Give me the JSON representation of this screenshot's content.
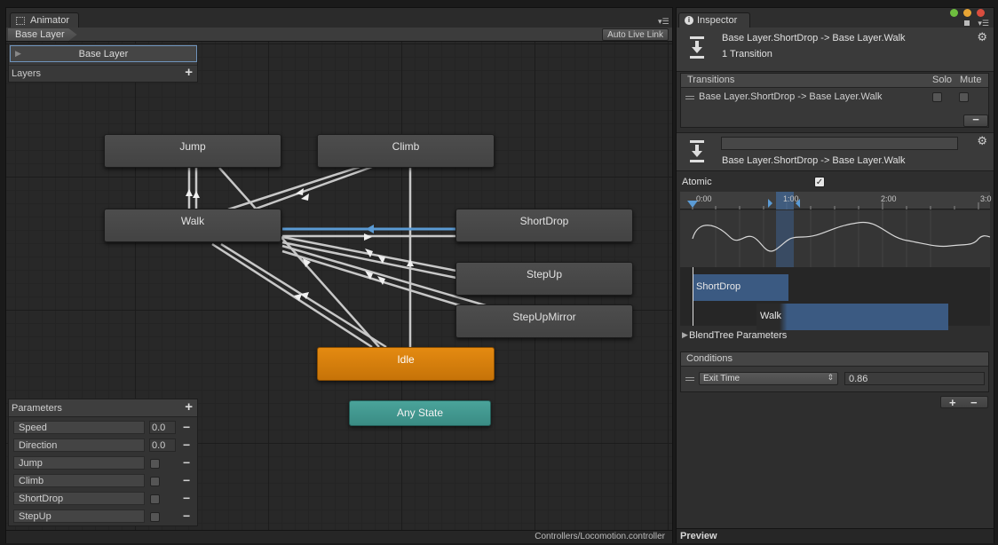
{
  "animator": {
    "tab_title": "Animator",
    "breadcrumb": "Base Layer",
    "auto_live_link": "Auto Live Link",
    "footer_path": "Controllers/Locomotion.controller",
    "layers": {
      "selected_layer": "Base Layer",
      "header": "Layers",
      "add_icon": "plus-icon"
    },
    "parameters": {
      "header": "Parameters",
      "items": [
        {
          "name": "Speed",
          "type": "float",
          "value": "0.0"
        },
        {
          "name": "Direction",
          "type": "float",
          "value": "0.0"
        },
        {
          "name": "Jump",
          "type": "bool",
          "checked": false
        },
        {
          "name": "Climb",
          "type": "bool",
          "checked": false
        },
        {
          "name": "ShortDrop",
          "type": "bool",
          "checked": false
        },
        {
          "name": "StepUp",
          "type": "bool",
          "checked": false
        }
      ]
    },
    "states": {
      "jump": "Jump",
      "climb": "Climb",
      "walk": "Walk",
      "shortdrop": "ShortDrop",
      "stepup": "StepUp",
      "stepupmirror": "StepUpMirror",
      "idle": "Idle",
      "any_state": "Any State"
    },
    "colors": {
      "node": "#484848",
      "default_state": "#d97f0e",
      "any_state": "#43998f",
      "selected_transition": "#5b9bd5",
      "transition": "#cfcfcf"
    }
  },
  "inspector": {
    "tab_title": "Inspector",
    "header_title": "Base Layer.ShortDrop -> Base Layer.Walk",
    "header_subtitle": "1 Transition",
    "transitions_label": "Transitions",
    "solo_label": "Solo",
    "mute_label": "Mute",
    "transition_row": "Base Layer.ShortDrop -> Base Layer.Walk",
    "transition_name_field": "",
    "transition_subtitle": "Base Layer.ShortDrop -> Base Layer.Walk",
    "atomic_label": "Atomic",
    "atomic_checked": true,
    "timeline": {
      "ticks": [
        "0:00",
        "1:00",
        "2:00",
        "3:0"
      ],
      "clip_source": "ShortDrop",
      "clip_dest": "Walk"
    },
    "blendtree_label": "BlendTree Parameters",
    "conditions": {
      "header": "Conditions",
      "condition_type": "Exit Time",
      "value": "0.86"
    },
    "preview_label": "Preview"
  }
}
